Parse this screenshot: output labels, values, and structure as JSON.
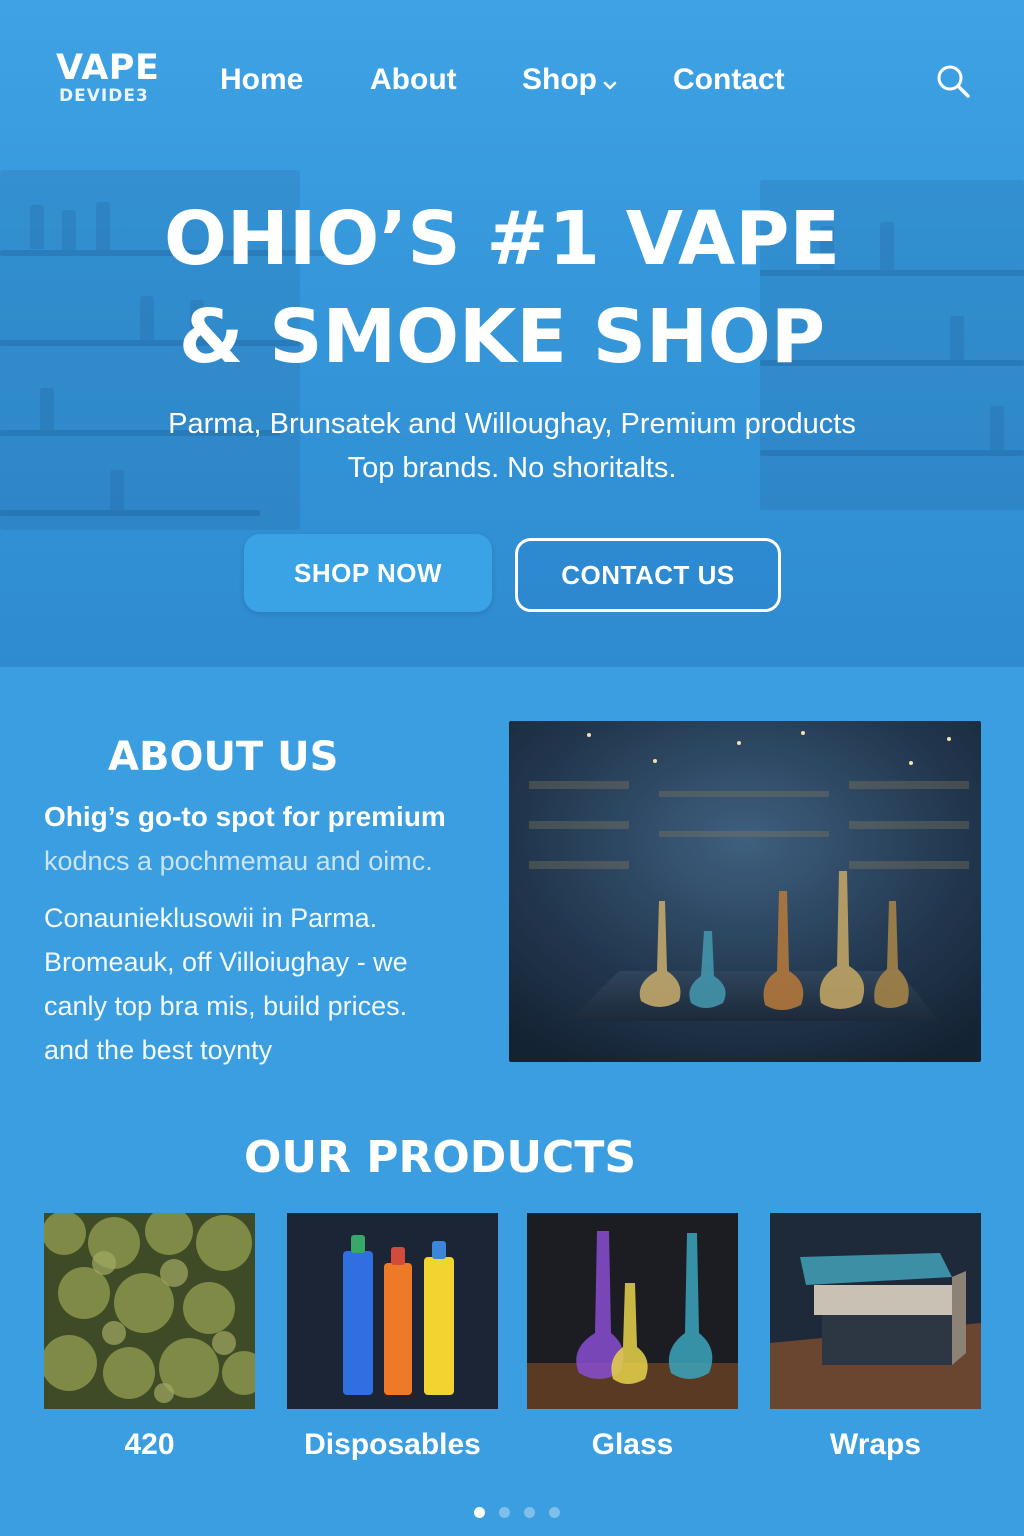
{
  "header": {
    "logo_top": "VAPE",
    "logo_bottom": "DEVIDE3",
    "nav": {
      "home": "Home",
      "about": "About",
      "shop": "Shop",
      "contact": "Contact"
    },
    "icons": {
      "shop_dropdown": "chevron-down-icon",
      "search": "search-icon"
    }
  },
  "hero": {
    "title_line1": "OHIO’S #1 VAPE",
    "title_line2": "& SMOKE SHOP",
    "subtitle_line1": "Parma, Brunsatek and Willoughay, Premium products",
    "subtitle_line2": "Top brands. No shoritalts.",
    "cta_primary": "SHOP NOW",
    "cta_secondary": "CONTACT US"
  },
  "about": {
    "title": "ABOUT US",
    "line1": "Ohig’s go-to spot for premium",
    "line2": "kodncs a pochmemau and oimc.",
    "line3": "Conaunieklusowii in Parma.",
    "line4": "Bromeauk, off Villoiughay - we",
    "line5": "canly top bra mis, build prices.",
    "line6": "and the best toynty"
  },
  "products": {
    "title": "OUR PRODUCTS",
    "items": [
      {
        "label": "420"
      },
      {
        "label": "Disposables"
      },
      {
        "label": "Glass"
      },
      {
        "label": "Wraps"
      }
    ]
  },
  "carousel": {
    "count": 4,
    "active": 1
  },
  "colors": {
    "background": "#3a9ee0",
    "primary_button": "#3aa3e6",
    "text": "#ffffff"
  }
}
